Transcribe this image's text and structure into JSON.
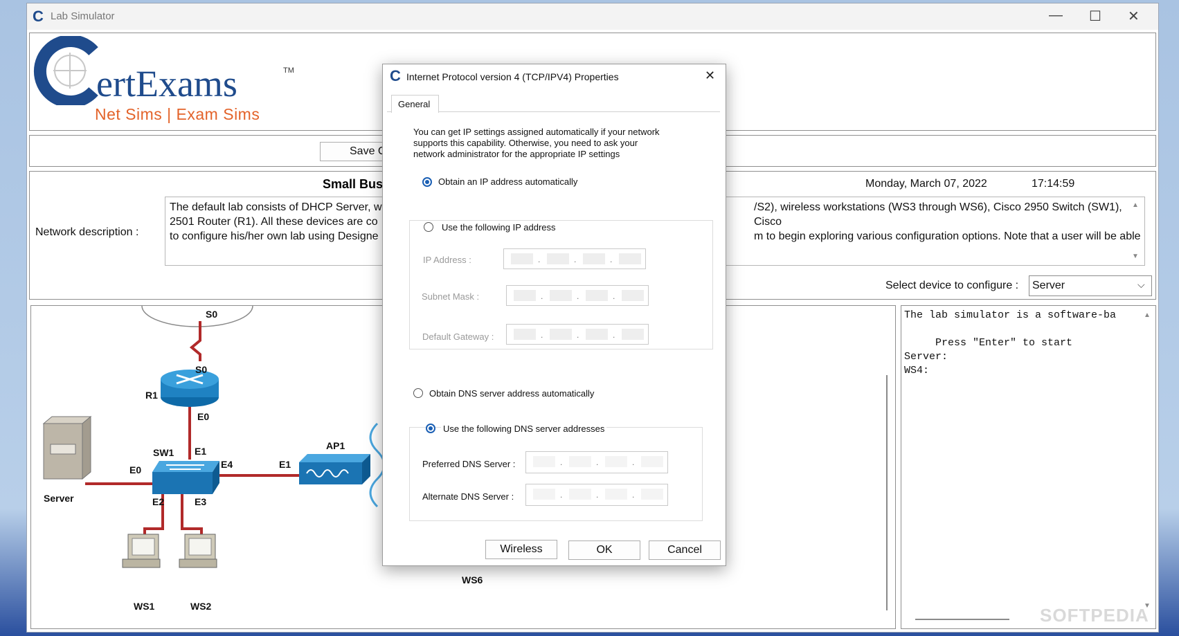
{
  "window": {
    "title": "Lab Simulator",
    "minimize": "—",
    "maximize": "☐",
    "close": "✕"
  },
  "logo": {
    "brand": "CertExams",
    "brand_rest": "ertExams",
    "tm": "TM",
    "tagline": "Net Sims | Exam Sims"
  },
  "toolbar": {
    "save_label": "Save C"
  },
  "lab": {
    "title": "Small Busi",
    "date": "Monday, March 07, 2022",
    "time": "17:14:59",
    "network_description_label": "Network description :",
    "description_left": [
      "The default lab consists of DHCP Server, w",
      "2501 Router (R1). All these devices are co",
      "to configure his/her own lab using Designe"
    ],
    "description_right": [
      "/S2), wireless workstations (WS3 through WS6), Cisco 2950 Switch (SW1), Cisco",
      "m to begin exploring various configuration options. Note that a user will be able"
    ],
    "select_device_label": "Select device to configure :",
    "selected_device": "Server"
  },
  "console": {
    "lines": [
      "The lab simulator is a software-ba",
      "",
      "     Press \"Enter\" to start",
      "Server:",
      "WS4:"
    ],
    "watermark": "SOFTPEDIA"
  },
  "topology": {
    "labels": {
      "s0_top": "S0",
      "s0_r1": "S0",
      "r1": "R1",
      "e0_r1": "E0",
      "sw1": "SW1",
      "e1_sw": "E1",
      "e0_sw": "E0",
      "e4_sw": "E4",
      "e1_ap": "E1",
      "ap1": "AP1",
      "e2_sw": "E2",
      "e3_sw": "E3",
      "server": "Server",
      "ws1": "WS1",
      "ws2": "WS2",
      "ws6": "WS6"
    }
  },
  "dialog": {
    "title": "Internet Protocol version 4 (TCP/IPV4) Properties",
    "tab_general": "General",
    "intro": [
      "You can get IP settings assigned automatically if your network",
      "supports this capability. Otherwise, you need to ask your",
      "network administrator for the appropriate IP settings"
    ],
    "obtain_ip_auto": "Obtain an IP address automatically",
    "use_following_ip": "Use the following IP address",
    "ip_address_label": "IP Address :",
    "subnet_mask_label": "Subnet Mask :",
    "default_gateway_label": "Default Gateway :",
    "obtain_dns_auto": "Obtain DNS server address automatically",
    "use_following_dns": "Use the following DNS server addresses",
    "preferred_dns_label": "Preferred DNS Server :",
    "alternate_dns_label": "Alternate DNS Server :",
    "wireless_button": "Wireless",
    "ok_button": "OK",
    "cancel_button": "Cancel",
    "dot": "."
  }
}
